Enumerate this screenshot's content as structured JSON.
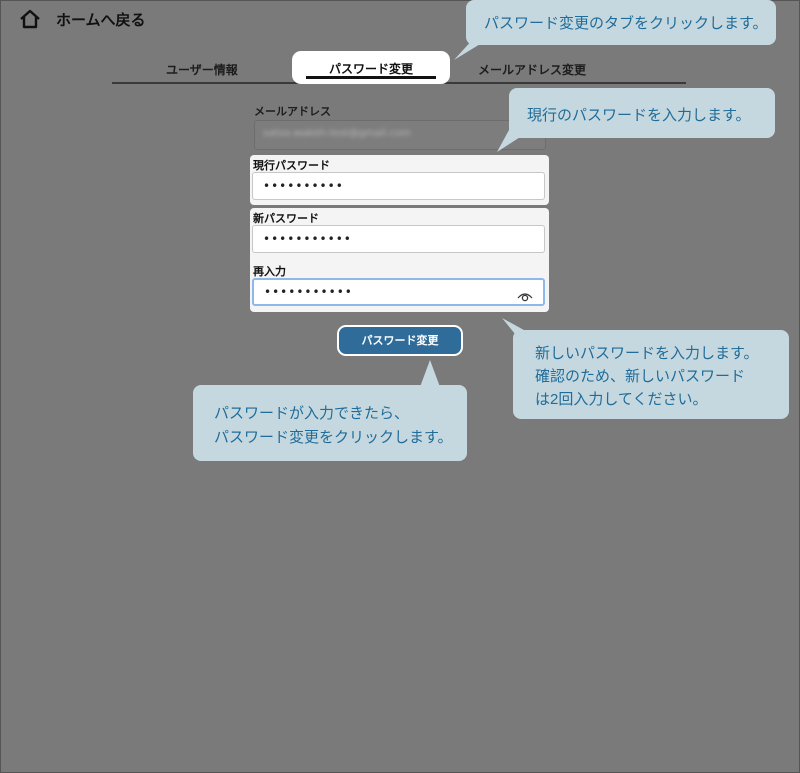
{
  "header": {
    "home_label": "ホームへ戻る",
    "home_icon": "home-icon"
  },
  "tabs": [
    {
      "label": "ユーザー情報",
      "active": false
    },
    {
      "label": "パスワード変更",
      "active": true
    },
    {
      "label": "メールアドレス変更",
      "active": false
    }
  ],
  "form": {
    "email_label": "メールアドレス",
    "email_value": "satoo.wakeh-test@gmail.com",
    "current_password_label": "現行パスワード",
    "current_password_value": "••••••••••",
    "new_password_label": "新パスワード",
    "new_password_value": "•••••••••••",
    "confirm_label": "再入力",
    "confirm_value": "•••••••••••",
    "submit_label": "パスワード変更"
  },
  "callouts": {
    "tab": "パスワード変更のタブをクリックします。",
    "current": "現行のパスワードを入力します。",
    "new_lines": [
      "新しいパスワードを入力します。",
      "確認のため、新しいパスワード",
      "は2回入力してください。"
    ],
    "submit_lines": [
      "パスワードが入力できたら、",
      "パスワード変更をクリックします。"
    ]
  },
  "colors": {
    "overlay": "#7a7a7a",
    "button": "#2f6c9a",
    "callout_bg": "#c6d8df",
    "callout_text": "#1f6c9a"
  }
}
